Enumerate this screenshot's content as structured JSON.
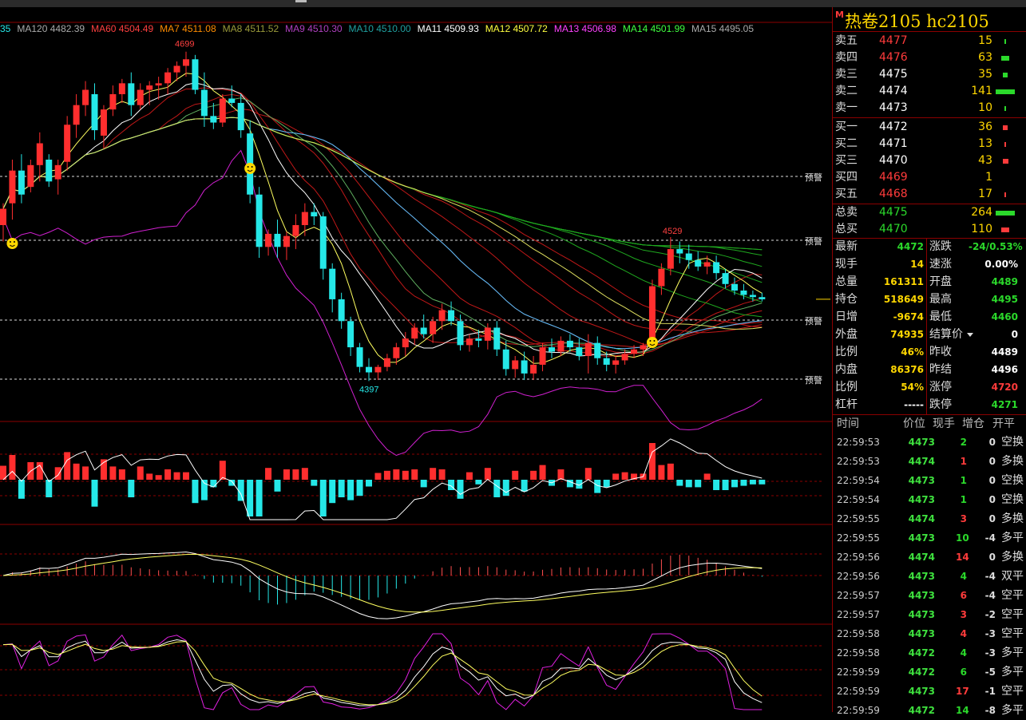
{
  "colors": {
    "up": "#ff2e2e",
    "down": "#25e8e8",
    "frame": "#8b0000",
    "title": "#ffd700",
    "green": "#2bd92b"
  },
  "ma_legend": [
    {
      "label": "35",
      "color": "#25e8e8"
    },
    {
      "label": "MA120 4482.39",
      "color": "#aaaaaa"
    },
    {
      "label": "MA60 4504.49",
      "color": "#ff4040"
    },
    {
      "label": "MA7 4511.08",
      "color": "#ff8c00"
    },
    {
      "label": "MA8 4511.52",
      "color": "#9a9a3a"
    },
    {
      "label": "MA9 4510.30",
      "color": "#b040c0"
    },
    {
      "label": "MA10 4510.00",
      "color": "#20a0a0"
    },
    {
      "label": "MA11 4509.93",
      "color": "#ffffff"
    },
    {
      "label": "MA12 4507.72",
      "color": "#ffff40"
    },
    {
      "label": "MA13 4506.98",
      "color": "#ff40ff"
    },
    {
      "label": "MA14 4501.99",
      "color": "#40ff40"
    },
    {
      "label": "MA15 4495.05",
      "color": "#aaaaaa"
    }
  ],
  "chart_annotations": {
    "high_label": "4699",
    "low_label": "4397",
    "mid_label": "4529",
    "alert_label": "预警"
  },
  "title": {
    "marker": "M",
    "text": "热卷2105  hc2105"
  },
  "order_book": {
    "asks": [
      {
        "label": "卖五",
        "price": "4477",
        "vol": "15",
        "pcolor": "red",
        "bar_w": 2,
        "bar_color": "#2bd92b"
      },
      {
        "label": "卖四",
        "price": "4476",
        "vol": "63",
        "pcolor": "red",
        "bar_w": 10,
        "bar_color": "#2bd92b"
      },
      {
        "label": "卖三",
        "price": "4475",
        "vol": "35",
        "pcolor": "white",
        "bar_w": 6,
        "bar_color": "#2bd92b"
      },
      {
        "label": "卖二",
        "price": "4474",
        "vol": "141",
        "pcolor": "white",
        "bar_w": 24,
        "bar_color": "#2bd92b"
      },
      {
        "label": "卖一",
        "price": "4473",
        "vol": "10",
        "pcolor": "white",
        "bar_w": 2,
        "bar_color": "#2bd92b"
      }
    ],
    "bids": [
      {
        "label": "买一",
        "price": "4472",
        "vol": "36",
        "pcolor": "white",
        "bar_w": 6,
        "bar_color": "#ff3b3b"
      },
      {
        "label": "买二",
        "price": "4471",
        "vol": "13",
        "pcolor": "white",
        "bar_w": 2,
        "bar_color": "#ff3b3b"
      },
      {
        "label": "买三",
        "price": "4470",
        "vol": "43",
        "pcolor": "white",
        "bar_w": 7,
        "bar_color": "#ff3b3b"
      },
      {
        "label": "买四",
        "price": "4469",
        "vol": "1",
        "pcolor": "red",
        "bar_w": 0,
        "bar_color": "#ff3b3b"
      },
      {
        "label": "买五",
        "price": "4468",
        "vol": "17",
        "pcolor": "red",
        "bar_w": 2,
        "bar_color": "#ff3b3b"
      }
    ],
    "totals": [
      {
        "label": "总卖",
        "price": "4475",
        "vol": "264",
        "pcolor": "green",
        "bar_w": 24,
        "bar_color": "#2bd92b"
      },
      {
        "label": "总买",
        "price": "4470",
        "vol": "110",
        "pcolor": "green",
        "bar_w": 10,
        "bar_color": "#ff3b3b"
      }
    ]
  },
  "stats": [
    {
      "l1": "最新",
      "v1": "4472",
      "c1": "green",
      "l2": "涨跌",
      "v2": "-24/0.53%",
      "c2": "green"
    },
    {
      "l1": "现手",
      "v1": "14",
      "c1": "yellow",
      "l2": "速涨",
      "v2": "0.00%",
      "c2": "white"
    },
    {
      "l1": "总量",
      "v1": "161311",
      "c1": "yellow",
      "l2": "开盘",
      "v2": "4489",
      "c2": "green"
    },
    {
      "l1": "持仓",
      "v1": "518649",
      "c1": "yellow",
      "l2": "最高",
      "v2": "4495",
      "c2": "green"
    },
    {
      "l1": "日增",
      "v1": "-9674",
      "c1": "yellow",
      "l2": "最低",
      "v2": "4460",
      "c2": "green"
    },
    {
      "l1": "外盘",
      "v1": "74935",
      "c1": "yellow",
      "l2": "结算价",
      "v2": "0",
      "c2": "white"
    },
    {
      "l1": "比例",
      "v1": "46%",
      "c1": "yellow",
      "l2": "昨收",
      "v2": "4489",
      "c2": "white"
    },
    {
      "l1": "内盘",
      "v1": "86376",
      "c1": "yellow",
      "l2": "昨结",
      "v2": "4496",
      "c2": "white"
    },
    {
      "l1": "比例",
      "v1": "54%",
      "c1": "yellow",
      "l2": "涨停",
      "v2": "4720",
      "c2": "red"
    },
    {
      "l1": "杠杆",
      "v1": "-----",
      "c1": "white",
      "l2": "跌停",
      "v2": "4271",
      "c2": "green"
    }
  ],
  "ticks_header": {
    "time": "时间",
    "price": "价位",
    "hand": "现手",
    "delta": "增仓",
    "kind": "开平"
  },
  "ticks": [
    {
      "time": "22:59:53",
      "price": "4473",
      "vol": "2",
      "vcolor": "green",
      "delta": "0",
      "kind": "空换"
    },
    {
      "time": "22:59:53",
      "price": "4474",
      "vol": "1",
      "vcolor": "red",
      "delta": "0",
      "kind": "多换"
    },
    {
      "time": "22:59:54",
      "price": "4473",
      "vol": "1",
      "vcolor": "green",
      "delta": "0",
      "kind": "空换"
    },
    {
      "time": "22:59:54",
      "price": "4473",
      "vol": "1",
      "vcolor": "green",
      "delta": "0",
      "kind": "空换"
    },
    {
      "time": "22:59:55",
      "price": "4474",
      "vol": "3",
      "vcolor": "red",
      "delta": "0",
      "kind": "多换"
    },
    {
      "time": "22:59:55",
      "price": "4473",
      "vol": "10",
      "vcolor": "green",
      "delta": "-4",
      "kind": "多平"
    },
    {
      "time": "22:59:56",
      "price": "4474",
      "vol": "14",
      "vcolor": "red",
      "delta": "0",
      "kind": "多换"
    },
    {
      "time": "22:59:56",
      "price": "4473",
      "vol": "4",
      "vcolor": "green",
      "delta": "-4",
      "kind": "双平"
    },
    {
      "time": "22:59:57",
      "price": "4473",
      "vol": "6",
      "vcolor": "red",
      "delta": "-4",
      "kind": "空平"
    },
    {
      "time": "22:59:57",
      "price": "4473",
      "vol": "3",
      "vcolor": "red",
      "delta": "-2",
      "kind": "空平"
    },
    {
      "time": "22:59:58",
      "price": "4473",
      "vol": "4",
      "vcolor": "red",
      "delta": "-3",
      "kind": "空平"
    },
    {
      "time": "22:59:58",
      "price": "4472",
      "vol": "4",
      "vcolor": "green",
      "delta": "-3",
      "kind": "多平"
    },
    {
      "time": "22:59:59",
      "price": "4472",
      "vol": "6",
      "vcolor": "green",
      "delta": "-5",
      "kind": "多平"
    },
    {
      "time": "22:59:59",
      "price": "4473",
      "vol": "17",
      "vcolor": "red",
      "delta": "-1",
      "kind": "空平"
    },
    {
      "time": "22:59:59",
      "price": "4472",
      "vol": "14",
      "vcolor": "green",
      "delta": "-8",
      "kind": "多平"
    }
  ],
  "chart_data": {
    "type": "candlestick",
    "title": "",
    "xlabel": "",
    "ylabel": "",
    "ylim": [
      4380,
      4720
    ],
    "ohlc": [
      [
        4540,
        4560,
        4525,
        4555
      ],
      [
        4560,
        4600,
        4545,
        4590
      ],
      [
        4590,
        4605,
        4560,
        4568
      ],
      [
        4575,
        4600,
        4570,
        4595
      ],
      [
        4595,
        4625,
        4580,
        4615
      ],
      [
        4600,
        4605,
        4575,
        4580
      ],
      [
        4582,
        4600,
        4568,
        4595
      ],
      [
        4598,
        4640,
        4590,
        4632
      ],
      [
        4632,
        4660,
        4620,
        4650
      ],
      [
        4650,
        4672,
        4640,
        4664
      ],
      [
        4660,
        4670,
        4618,
        4627
      ],
      [
        4622,
        4650,
        4610,
        4646
      ],
      [
        4646,
        4668,
        4640,
        4660
      ],
      [
        4660,
        4674,
        4652,
        4670
      ],
      [
        4670,
        4680,
        4640,
        4650
      ],
      [
        4650,
        4670,
        4646,
        4664
      ],
      [
        4664,
        4672,
        4650,
        4668
      ],
      [
        4668,
        4676,
        4655,
        4670
      ],
      [
        4670,
        4684,
        4660,
        4680
      ],
      [
        4680,
        4690,
        4672,
        4686
      ],
      [
        4686,
        4699,
        4676,
        4692
      ],
      [
        4692,
        4696,
        4660,
        4664
      ],
      [
        4664,
        4680,
        4630,
        4640
      ],
      [
        4640,
        4652,
        4628,
        4634
      ],
      [
        4634,
        4660,
        4630,
        4656
      ],
      [
        4656,
        4668,
        4648,
        4652
      ],
      [
        4652,
        4660,
        4620,
        4627
      ],
      [
        4624,
        4636,
        4560,
        4568
      ],
      [
        4568,
        4575,
        4510,
        4520
      ],
      [
        4520,
        4536,
        4512,
        4532
      ],
      [
        4532,
        4545,
        4510,
        4520
      ],
      [
        4520,
        4534,
        4508,
        4530
      ],
      [
        4530,
        4550,
        4518,
        4540
      ],
      [
        4540,
        4560,
        4530,
        4552
      ],
      [
        4552,
        4560,
        4540,
        4548
      ],
      [
        4548,
        4552,
        4490,
        4500
      ],
      [
        4500,
        4505,
        4460,
        4472
      ],
      [
        4472,
        4478,
        4445,
        4452
      ],
      [
        4452,
        4456,
        4420,
        4428
      ],
      [
        4428,
        4432,
        4405,
        4410
      ],
      [
        4410,
        4418,
        4397,
        4405
      ],
      [
        4405,
        4412,
        4398,
        4410
      ],
      [
        4410,
        4422,
        4406,
        4418
      ],
      [
        4418,
        4432,
        4412,
        4428
      ],
      [
        4428,
        4442,
        4420,
        4436
      ],
      [
        4436,
        4450,
        4430,
        4446
      ],
      [
        4446,
        4458,
        4436,
        4440
      ],
      [
        4440,
        4456,
        4432,
        4452
      ],
      [
        4452,
        4468,
        4444,
        4462
      ],
      [
        4462,
        4470,
        4448,
        4452
      ],
      [
        4452,
        4458,
        4425,
        4430
      ],
      [
        4430,
        4440,
        4424,
        4436
      ],
      [
        4436,
        4444,
        4428,
        4434
      ],
      [
        4434,
        4450,
        4426,
        4446
      ],
      [
        4446,
        4452,
        4420,
        4426
      ],
      [
        4426,
        4434,
        4402,
        4408
      ],
      [
        4408,
        4420,
        4400,
        4416
      ],
      [
        4416,
        4424,
        4398,
        4404
      ],
      [
        4404,
        4420,
        4398,
        4412
      ],
      [
        4412,
        4432,
        4406,
        4428
      ],
      [
        4428,
        4436,
        4418,
        4424
      ],
      [
        4424,
        4438,
        4420,
        4434
      ],
      [
        4434,
        4440,
        4424,
        4428
      ],
      [
        4428,
        4436,
        4416,
        4420
      ],
      [
        4420,
        4440,
        4404,
        4432
      ],
      [
        4432,
        4438,
        4412,
        4418
      ],
      [
        4418,
        4424,
        4406,
        4412
      ],
      [
        4412,
        4420,
        4404,
        4416
      ],
      [
        4416,
        4426,
        4412,
        4422
      ],
      [
        4422,
        4430,
        4418,
        4426
      ],
      [
        4426,
        4432,
        4420,
        4430
      ],
      [
        4430,
        4490,
        4428,
        4484
      ],
      [
        4484,
        4505,
        4476,
        4500
      ],
      [
        4500,
        4529,
        4494,
        4518
      ],
      [
        4518,
        4525,
        4505,
        4514
      ],
      [
        4514,
        4522,
        4500,
        4508
      ],
      [
        4508,
        4516,
        4498,
        4502
      ],
      [
        4502,
        4512,
        4495,
        4506
      ],
      [
        4506,
        4512,
        4490,
        4496
      ],
      [
        4496,
        4500,
        4482,
        4486
      ],
      [
        4486,
        4492,
        4476,
        4480
      ],
      [
        4480,
        4486,
        4472,
        4476
      ],
      [
        4476,
        4480,
        4470,
        4474
      ],
      [
        4474,
        4478,
        4470,
        4472
      ]
    ]
  }
}
